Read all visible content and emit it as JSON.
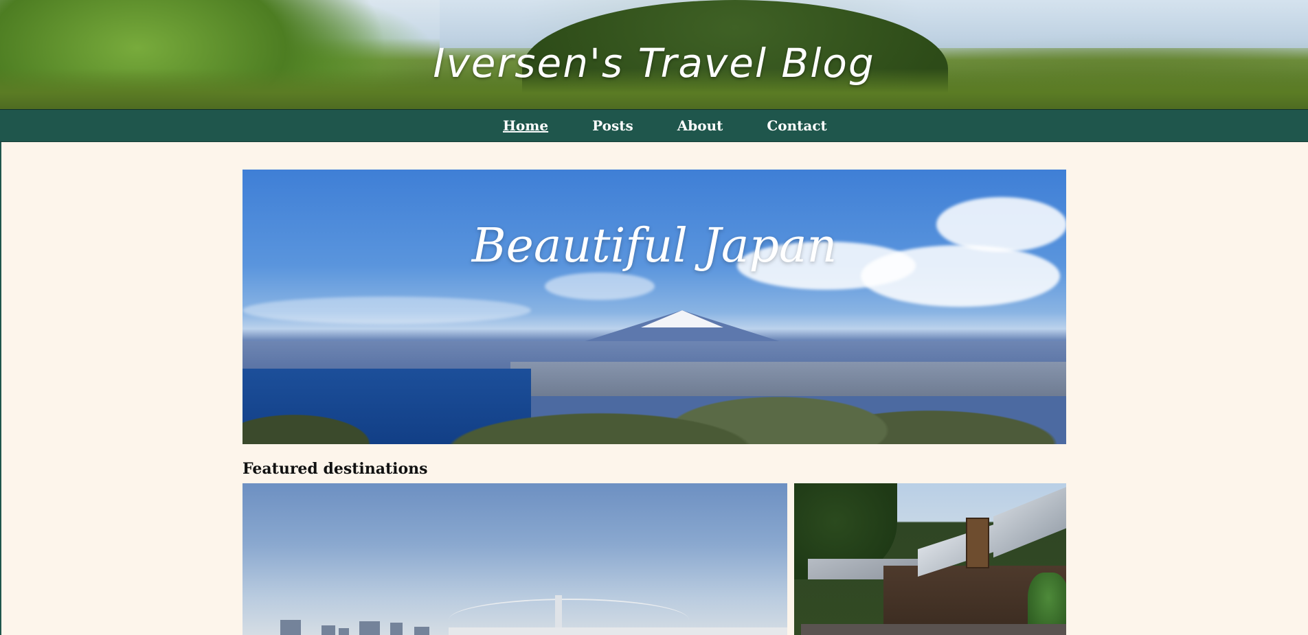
{
  "header": {
    "site_title": "Iversen's Travel Blog"
  },
  "nav": {
    "items": [
      {
        "label": "Home",
        "active": true
      },
      {
        "label": "Posts",
        "active": false
      },
      {
        "label": "About",
        "active": false
      },
      {
        "label": "Contact",
        "active": false
      }
    ]
  },
  "hero": {
    "title": "Beautiful Japan"
  },
  "featured": {
    "heading": "Featured destinations"
  },
  "colors": {
    "navbar": "#1f564c",
    "page_background": "#fdf5eb",
    "title_text": "#ffffff"
  }
}
